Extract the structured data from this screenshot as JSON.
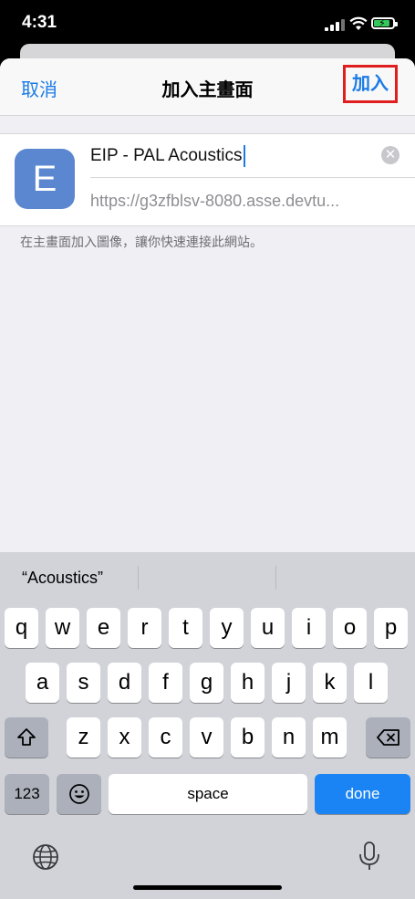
{
  "status": {
    "time": "4:31"
  },
  "sheet": {
    "cancel": "取消",
    "title": "加入主畫面",
    "add": "加入",
    "app_icon_letter": "E",
    "name_value": "EIP - PAL Acoustics",
    "url_value": "https://g3zfblsv-8080.asse.devtu...",
    "hint": "在主畫面加入圖像，讓你快速連接此網站。"
  },
  "keyboard": {
    "suggestion": "“Acoustics”",
    "row1": [
      "q",
      "w",
      "e",
      "r",
      "t",
      "y",
      "u",
      "i",
      "o",
      "p"
    ],
    "row2": [
      "a",
      "s",
      "d",
      "f",
      "g",
      "h",
      "j",
      "k",
      "l"
    ],
    "row3": [
      "z",
      "x",
      "c",
      "v",
      "b",
      "n",
      "m"
    ],
    "numbers": "123",
    "space": "space",
    "done": "done"
  }
}
